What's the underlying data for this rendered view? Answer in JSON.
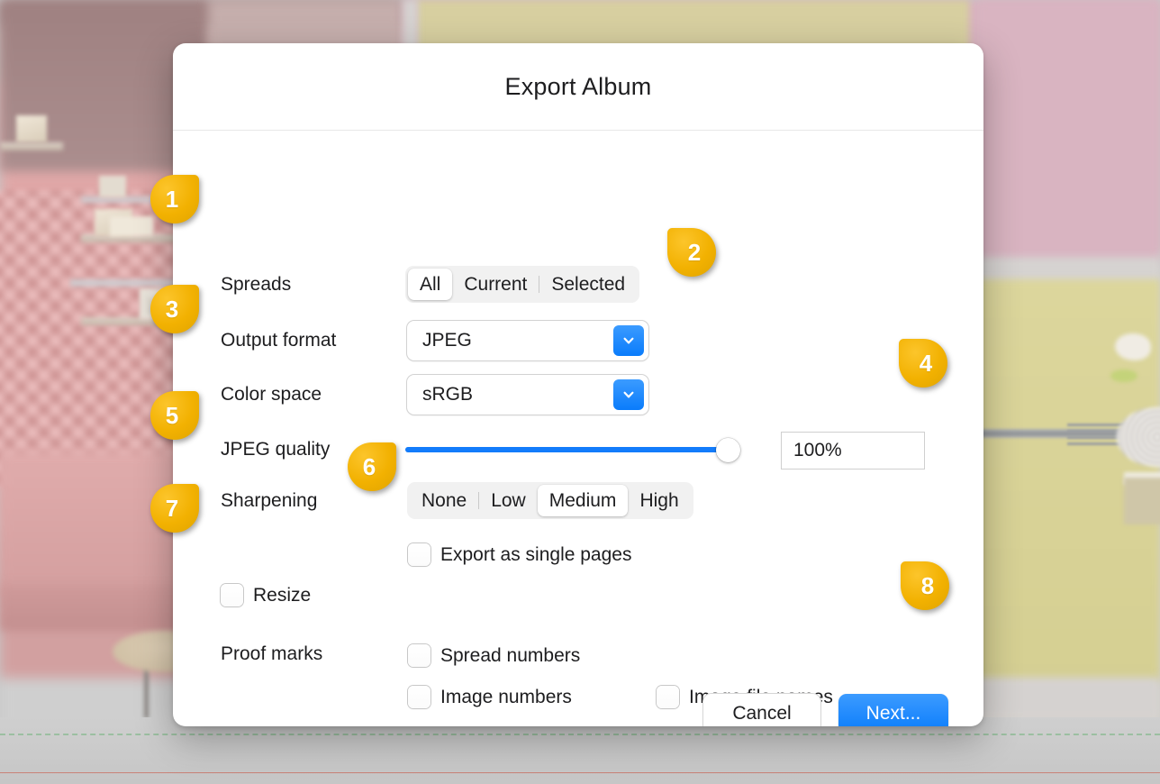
{
  "dialog": {
    "title": "Export Album",
    "rows": {
      "spreads": {
        "label": "Spreads",
        "options": [
          "All",
          "Current",
          "Selected"
        ],
        "selected": "All"
      },
      "output_format": {
        "label": "Output format",
        "value": "JPEG"
      },
      "color_space": {
        "label": "Color space",
        "value": "sRGB"
      },
      "jpeg_quality": {
        "label": "JPEG quality",
        "value": "100%",
        "percent": 100
      },
      "sharpening": {
        "label": "Sharpening",
        "options": [
          "None",
          "Low",
          "Medium",
          "High"
        ],
        "selected": "Medium"
      },
      "export_single_pages": {
        "label": "Export as single pages",
        "checked": false
      },
      "resize": {
        "label": "Resize",
        "checked": false
      },
      "proof_marks": {
        "label": "Proof marks",
        "items": [
          {
            "label": "Spread numbers",
            "checked": false
          },
          {
            "label": "Image numbers",
            "checked": false
          },
          {
            "label": "Image file names",
            "checked": false
          }
        ]
      }
    },
    "buttons": {
      "cancel": "Cancel",
      "next": "Next..."
    }
  },
  "callouts": [
    {
      "number": "1",
      "direction": "right"
    },
    {
      "number": "2",
      "direction": "left"
    },
    {
      "number": "3",
      "direction": "right"
    },
    {
      "number": "4",
      "direction": "left"
    },
    {
      "number": "5",
      "direction": "right"
    },
    {
      "number": "6",
      "direction": "right"
    },
    {
      "number": "7",
      "direction": "right"
    },
    {
      "number": "8",
      "direction": "left"
    }
  ],
  "colors": {
    "accent_blue": "#0a7cfb",
    "badge_yellow": "#f2b101",
    "dialog_bg": "#ffffff",
    "text": "#1d1d1f"
  },
  "icons": {
    "chevron_down": "chevron-down-icon"
  }
}
